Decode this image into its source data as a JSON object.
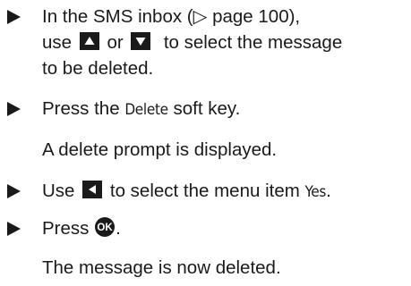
{
  "steps": [
    {
      "line1": "In the SMS inbox (▷ page 100),",
      "line2_a": "use",
      "line2_or": "or",
      "line2_b": "to select the message",
      "line3": "to be deleted.",
      "keys": [
        "up-arrow-key",
        "down-arrow-key"
      ]
    },
    {
      "text_a": "Press the",
      "softkey": "Delete",
      "text_b": "soft key.",
      "result": "A delete prompt is displayed."
    },
    {
      "text_a": "Use",
      "text_b": "to select the menu item",
      "menu_item": "Yes",
      "text_c": ".",
      "keys": [
        "left-arrow-key"
      ]
    },
    {
      "text_a": "Press",
      "text_b": ".",
      "keys": [
        "ok-key"
      ],
      "result": "The message is now deleted."
    }
  ],
  "colors": {
    "text": "#1a1a1a",
    "key_bg": "#1a1a1a",
    "key_glyph": "#ffffff"
  }
}
